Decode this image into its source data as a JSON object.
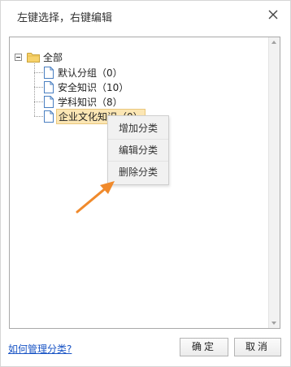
{
  "dialog": {
    "title": "左键选择，右键编辑",
    "close_icon": "close-icon"
  },
  "tree": {
    "root": {
      "label": "全部",
      "expanded": true,
      "icon": "folder-icon"
    },
    "children": [
      {
        "label": "默认分组（0）",
        "icon": "document-icon",
        "selected": false
      },
      {
        "label": "安全知识（10）",
        "icon": "document-icon",
        "selected": false
      },
      {
        "label": "学科知识（8）",
        "icon": "document-icon",
        "selected": false
      },
      {
        "label": "企业文化知识（0）",
        "icon": "document-icon",
        "selected": true
      }
    ]
  },
  "context_menu": {
    "items": [
      {
        "label": "增加分类"
      },
      {
        "label": "编辑分类"
      },
      {
        "label": "删除分类"
      }
    ]
  },
  "annotation": {
    "icon": "arrow-icon",
    "color": "#f08a2c"
  },
  "footer": {
    "help_link": "如何管理分类?",
    "ok_label": "确定",
    "cancel_label": "取消"
  },
  "colors": {
    "selection_bg": "#fbe6b4",
    "selection_border": "#eac77c",
    "link": "#1a55c5"
  }
}
